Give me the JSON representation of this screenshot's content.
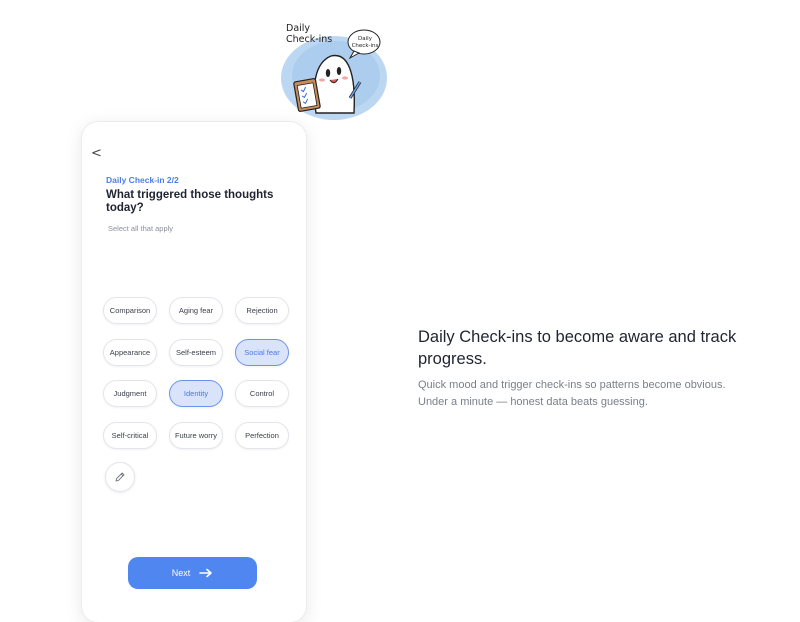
{
  "illustration": {
    "title": "Daily Check-ins",
    "bubble_text": "Daily Check-ins"
  },
  "phone": {
    "back_label": "<",
    "step_label": "Daily Check-in 2/2",
    "question": "What triggered those thoughts today?",
    "hint": "Select all that apply",
    "chips": [
      {
        "label": "Comparison",
        "selected": false
      },
      {
        "label": "Aging fear",
        "selected": false
      },
      {
        "label": "Rejection",
        "selected": false
      },
      {
        "label": "Appearance",
        "selected": false
      },
      {
        "label": "Self-esteem",
        "selected": false
      },
      {
        "label": "Social fear",
        "selected": true
      },
      {
        "label": "Judgment",
        "selected": false
      },
      {
        "label": "Identity",
        "selected": true
      },
      {
        "label": "Control",
        "selected": false
      },
      {
        "label": "Self-critical",
        "selected": false
      },
      {
        "label": "Future worry",
        "selected": false
      },
      {
        "label": "Perfection",
        "selected": false
      }
    ],
    "edit_icon": "pencil-icon",
    "next_label": "Next",
    "next_icon": "arrow-right-icon"
  },
  "feature": {
    "headline": "Daily Check-ins to become aware and track progress.",
    "description_line1": "Quick mood and trigger check-ins so patterns become obvious.",
    "description_line2": "Under a minute — honest data beats guessing."
  },
  "colors": {
    "accent": "#4f86f0",
    "selected_chip_bg": "#d9e4fb",
    "selected_chip_text": "#4a78e0",
    "step_text": "#4a7de8"
  }
}
